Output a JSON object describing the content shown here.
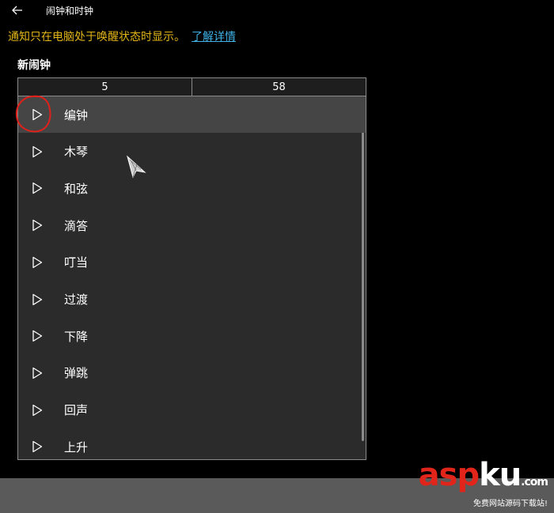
{
  "window": {
    "title": "闹钟和时钟",
    "back_icon": "back-arrow-icon"
  },
  "notice": {
    "text": "通知只在电脑处于唤醒状态时显示。",
    "link_label": "了解详情",
    "text_color": "#e2b517",
    "link_color": "#3fb3e8"
  },
  "section": {
    "heading": "新闹钟"
  },
  "time_picker": {
    "hour": "5",
    "minute": "58"
  },
  "sound_list": {
    "selected_index": 0,
    "items": [
      {
        "label": "编钟",
        "icon": "play-icon"
      },
      {
        "label": "木琴",
        "icon": "play-icon"
      },
      {
        "label": "和弦",
        "icon": "play-icon"
      },
      {
        "label": "滴答",
        "icon": "play-icon"
      },
      {
        "label": "叮当",
        "icon": "play-icon"
      },
      {
        "label": "过渡",
        "icon": "play-icon"
      },
      {
        "label": "下降",
        "icon": "play-icon"
      },
      {
        "label": "弹跳",
        "icon": "play-icon"
      },
      {
        "label": "回声",
        "icon": "play-icon"
      },
      {
        "label": "上升",
        "icon": "play-icon"
      }
    ]
  },
  "watermark": {
    "logo_red": "asp",
    "logo_white": "ku",
    "logo_suffix": ".com",
    "subtitle": "免费网站源码下载站!"
  }
}
